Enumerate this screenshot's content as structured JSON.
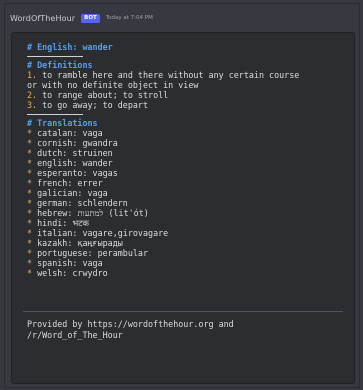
{
  "message": {
    "username": "WordOfTheHour",
    "badge": "BOT",
    "timestamp": "Today at 7:04 PM"
  },
  "heading": "# English: wander",
  "definitions": {
    "heading": "# Definitions",
    "items": [
      {
        "num": "1.",
        "text": " to ramble here and there without any certain course"
      },
      {
        "num": "",
        "text": "or with no definite object in view"
      },
      {
        "num": "2.",
        "text": " to range about; to stroll"
      },
      {
        "num": "3.",
        "text": " to go away; to depart"
      }
    ]
  },
  "translations": {
    "heading": "# Translations",
    "bullet": "*",
    "items": [
      {
        "text": "catalan: vaga"
      },
      {
        "text": "cornish: gwandra"
      },
      {
        "text": "dutch: struinen"
      },
      {
        "text": "english: wander"
      },
      {
        "text": "esperanto: vagas"
      },
      {
        "text": "french: errer"
      },
      {
        "text": "galician: vaga"
      },
      {
        "text": "german: schlendern"
      },
      {
        "text": "hebrew: למתעות (lit'ót)"
      },
      {
        "text": "hindi: भटक"
      },
      {
        "text": "italian: vagare,girovagare"
      },
      {
        "text": "kazakh: қаңғырады"
      },
      {
        "text": "portuguese: perambular"
      },
      {
        "text": "spanish: vaga"
      },
      {
        "text": "welsh: crwydro"
      }
    ]
  },
  "footer": {
    "line1": "Provided by https://wordofthehour.org and",
    "line2": "/r/Word_of_The_Hour"
  }
}
